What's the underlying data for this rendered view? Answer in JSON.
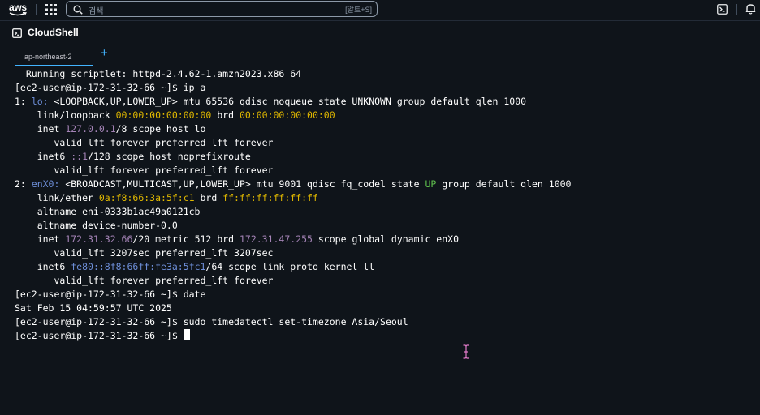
{
  "topnav": {
    "logo_text": "aws",
    "search_placeholder": "검색",
    "search_shortcut": "[알트+S]",
    "icons": [
      "aws-logo",
      "grid-icon",
      "search-icon",
      "cloudshell-icon",
      "bell-icon"
    ]
  },
  "cloudshell": {
    "title": "CloudShell"
  },
  "tabs": {
    "items": [
      {
        "label": "ap-northeast-2",
        "active": true
      }
    ],
    "add_label": "+"
  },
  "colors": {
    "background": "#0f141a",
    "accent": "#42b4ff",
    "interface_name": "#6e8fd9",
    "mac_address": "#e0b800",
    "ip_address": "#a584b7",
    "state_up": "#5fc04d"
  },
  "terminal": {
    "l00": "  Running scriptlet: httpd-2.4.62-1.amzn2023.x86_64",
    "l01": "[ec2-user@ip-172-31-32-66 ~]$ ip a",
    "l02": {
      "a": "1: ",
      "b": "lo:",
      "c": " <LOOPBACK,UP,LOWER_UP> mtu 65536 qdisc noqueue state UNKNOWN group default qlen 1000"
    },
    "l03": {
      "a": "    link/loopback ",
      "b": "00:00:00:00:00:00",
      "c": " brd ",
      "d": "00:00:00:00:00:00"
    },
    "l04": {
      "a": "    inet ",
      "b": "127.0.0.1",
      "c": "/8 scope host lo"
    },
    "l05": "       valid_lft forever preferred_lft forever",
    "l06": {
      "a": "    inet6 ",
      "b": "::1",
      "c": "/128 scope host noprefixroute"
    },
    "l07": "       valid_lft forever preferred_lft forever",
    "l08": {
      "a": "2: ",
      "b": "enX0:",
      "c": " <BROADCAST,MULTICAST,UP,LOWER_UP> mtu 9001 qdisc fq_codel state ",
      "d": "UP",
      "e": " group default qlen 1000"
    },
    "l09": {
      "a": "    link/ether ",
      "b": "0a:f8:66:3a:5f:c1",
      "c": " brd ",
      "d": "ff:ff:ff:ff:ff:ff"
    },
    "l10": "    altname eni-0333b1ac49a0121cb",
    "l11": "    altname device-number-0.0",
    "l12": {
      "a": "    inet ",
      "b": "172.31.32.66",
      "c": "/20 metric 512 brd ",
      "d": "172.31.47.255",
      "e": " scope global dynamic enX0"
    },
    "l13": "       valid_lft 3207sec preferred_lft 3207sec",
    "l14": {
      "a": "    inet6 ",
      "b": "fe80::8f8:66ff:fe3a:5fc1",
      "c": "/64 scope link proto kernel_ll"
    },
    "l15": "       valid_lft forever preferred_lft forever",
    "l16": "[ec2-user@ip-172-31-32-66 ~]$ date",
    "l17": "Sat Feb 15 04:59:57 UTC 2025",
    "l18": "[ec2-user@ip-172-31-32-66 ~]$ sudo timedatectl set-timezone Asia/Seoul",
    "l19": "[ec2-user@ip-172-31-32-66 ~]$ "
  }
}
